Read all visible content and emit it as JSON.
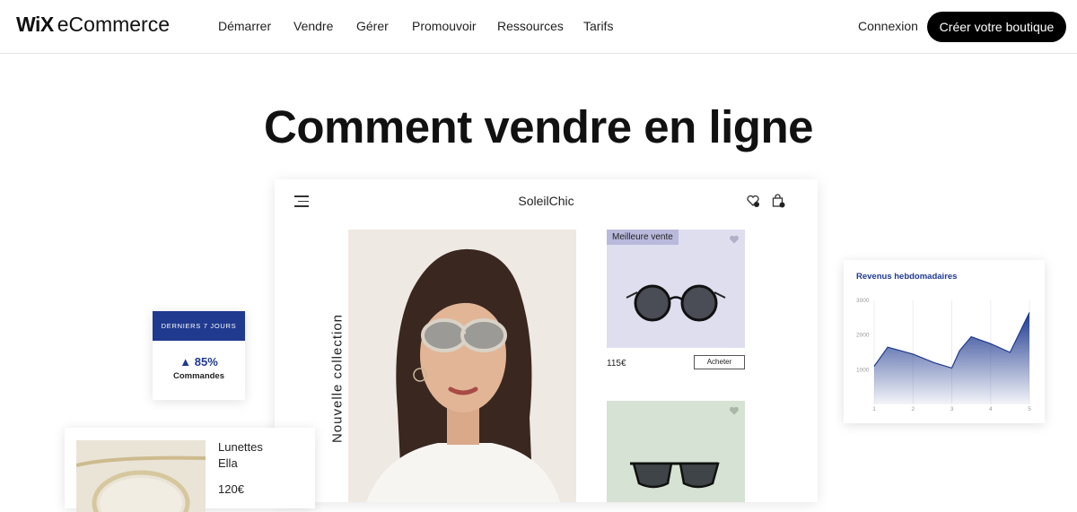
{
  "brand": {
    "wix": "WiX",
    "product": "eCommerce"
  },
  "nav": {
    "items": [
      "Démarrer",
      "Vendre",
      "Gérer",
      "Promouvoir",
      "Ressources",
      "Tarifs"
    ],
    "login": "Connexion",
    "cta": "Créer votre boutique"
  },
  "hero": {
    "title": "Comment vendre en ligne"
  },
  "store": {
    "name": "SoleilChic",
    "vertical_text": "Nouvelle collection",
    "product1": {
      "badge": "Meilleure vente",
      "price": "115€",
      "buy": "Acheter"
    }
  },
  "stat_card": {
    "header": "DERNIERS 7 JOURS",
    "value": "▲ 85%",
    "label": "Commandes"
  },
  "revenue_card": {
    "title": "Revenus hebdomadaires"
  },
  "product_card": {
    "name_line1": "Lunettes",
    "name_line2": "Ella",
    "price": "120€"
  },
  "chart_data": {
    "type": "area",
    "title": "Revenus hebdomadaires",
    "x": [
      1,
      2,
      3,
      4,
      5
    ],
    "yticks": [
      1000,
      2000,
      3000
    ],
    "ylim": [
      0,
      3000
    ],
    "x_points": [
      1,
      1.35,
      2,
      2.55,
      3,
      3.2,
      3.5,
      4,
      4.5,
      5
    ],
    "y_points": [
      1100,
      1650,
      1450,
      1200,
      1050,
      1550,
      1950,
      1750,
      1500,
      2650
    ],
    "color": "#1f3a8f",
    "grid": "vertical"
  },
  "colors": {
    "accent": "#1f3a8f",
    "cta_bg": "#000000",
    "purple_tile": "#dedeef",
    "green_tile": "#d6e2d3"
  }
}
